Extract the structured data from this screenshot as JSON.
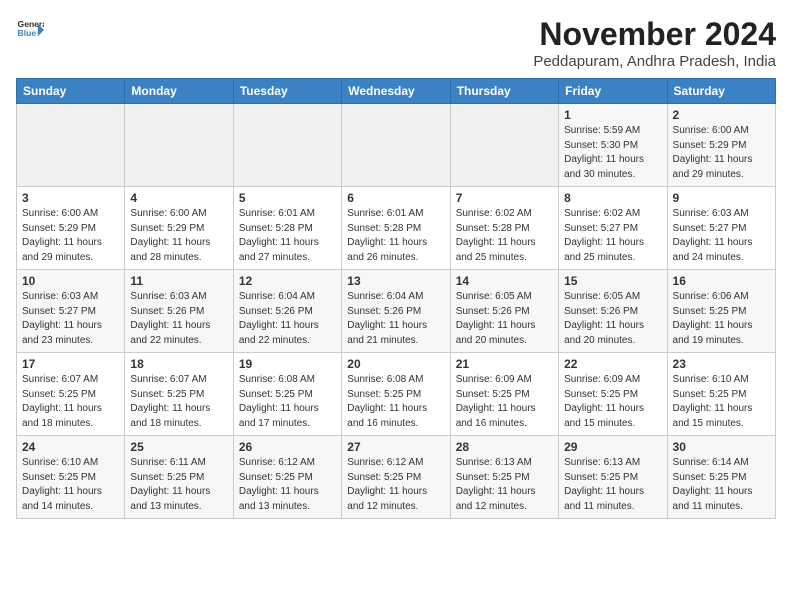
{
  "header": {
    "logo_general": "General",
    "logo_blue": "Blue",
    "title": "November 2024",
    "subtitle": "Peddapuram, Andhra Pradesh, India"
  },
  "weekdays": [
    "Sunday",
    "Monday",
    "Tuesday",
    "Wednesday",
    "Thursday",
    "Friday",
    "Saturday"
  ],
  "weeks": [
    [
      {
        "day": "",
        "info": ""
      },
      {
        "day": "",
        "info": ""
      },
      {
        "day": "",
        "info": ""
      },
      {
        "day": "",
        "info": ""
      },
      {
        "day": "",
        "info": ""
      },
      {
        "day": "1",
        "info": "Sunrise: 5:59 AM\nSunset: 5:30 PM\nDaylight: 11 hours and 30 minutes."
      },
      {
        "day": "2",
        "info": "Sunrise: 6:00 AM\nSunset: 5:29 PM\nDaylight: 11 hours and 29 minutes."
      }
    ],
    [
      {
        "day": "3",
        "info": "Sunrise: 6:00 AM\nSunset: 5:29 PM\nDaylight: 11 hours and 29 minutes."
      },
      {
        "day": "4",
        "info": "Sunrise: 6:00 AM\nSunset: 5:29 PM\nDaylight: 11 hours and 28 minutes."
      },
      {
        "day": "5",
        "info": "Sunrise: 6:01 AM\nSunset: 5:28 PM\nDaylight: 11 hours and 27 minutes."
      },
      {
        "day": "6",
        "info": "Sunrise: 6:01 AM\nSunset: 5:28 PM\nDaylight: 11 hours and 26 minutes."
      },
      {
        "day": "7",
        "info": "Sunrise: 6:02 AM\nSunset: 5:28 PM\nDaylight: 11 hours and 25 minutes."
      },
      {
        "day": "8",
        "info": "Sunrise: 6:02 AM\nSunset: 5:27 PM\nDaylight: 11 hours and 25 minutes."
      },
      {
        "day": "9",
        "info": "Sunrise: 6:03 AM\nSunset: 5:27 PM\nDaylight: 11 hours and 24 minutes."
      }
    ],
    [
      {
        "day": "10",
        "info": "Sunrise: 6:03 AM\nSunset: 5:27 PM\nDaylight: 11 hours and 23 minutes."
      },
      {
        "day": "11",
        "info": "Sunrise: 6:03 AM\nSunset: 5:26 PM\nDaylight: 11 hours and 22 minutes."
      },
      {
        "day": "12",
        "info": "Sunrise: 6:04 AM\nSunset: 5:26 PM\nDaylight: 11 hours and 22 minutes."
      },
      {
        "day": "13",
        "info": "Sunrise: 6:04 AM\nSunset: 5:26 PM\nDaylight: 11 hours and 21 minutes."
      },
      {
        "day": "14",
        "info": "Sunrise: 6:05 AM\nSunset: 5:26 PM\nDaylight: 11 hours and 20 minutes."
      },
      {
        "day": "15",
        "info": "Sunrise: 6:05 AM\nSunset: 5:26 PM\nDaylight: 11 hours and 20 minutes."
      },
      {
        "day": "16",
        "info": "Sunrise: 6:06 AM\nSunset: 5:25 PM\nDaylight: 11 hours and 19 minutes."
      }
    ],
    [
      {
        "day": "17",
        "info": "Sunrise: 6:07 AM\nSunset: 5:25 PM\nDaylight: 11 hours and 18 minutes."
      },
      {
        "day": "18",
        "info": "Sunrise: 6:07 AM\nSunset: 5:25 PM\nDaylight: 11 hours and 18 minutes."
      },
      {
        "day": "19",
        "info": "Sunrise: 6:08 AM\nSunset: 5:25 PM\nDaylight: 11 hours and 17 minutes."
      },
      {
        "day": "20",
        "info": "Sunrise: 6:08 AM\nSunset: 5:25 PM\nDaylight: 11 hours and 16 minutes."
      },
      {
        "day": "21",
        "info": "Sunrise: 6:09 AM\nSunset: 5:25 PM\nDaylight: 11 hours and 16 minutes."
      },
      {
        "day": "22",
        "info": "Sunrise: 6:09 AM\nSunset: 5:25 PM\nDaylight: 11 hours and 15 minutes."
      },
      {
        "day": "23",
        "info": "Sunrise: 6:10 AM\nSunset: 5:25 PM\nDaylight: 11 hours and 15 minutes."
      }
    ],
    [
      {
        "day": "24",
        "info": "Sunrise: 6:10 AM\nSunset: 5:25 PM\nDaylight: 11 hours and 14 minutes."
      },
      {
        "day": "25",
        "info": "Sunrise: 6:11 AM\nSunset: 5:25 PM\nDaylight: 11 hours and 13 minutes."
      },
      {
        "day": "26",
        "info": "Sunrise: 6:12 AM\nSunset: 5:25 PM\nDaylight: 11 hours and 13 minutes."
      },
      {
        "day": "27",
        "info": "Sunrise: 6:12 AM\nSunset: 5:25 PM\nDaylight: 11 hours and 12 minutes."
      },
      {
        "day": "28",
        "info": "Sunrise: 6:13 AM\nSunset: 5:25 PM\nDaylight: 11 hours and 12 minutes."
      },
      {
        "day": "29",
        "info": "Sunrise: 6:13 AM\nSunset: 5:25 PM\nDaylight: 11 hours and 11 minutes."
      },
      {
        "day": "30",
        "info": "Sunrise: 6:14 AM\nSunset: 5:25 PM\nDaylight: 11 hours and 11 minutes."
      }
    ]
  ]
}
